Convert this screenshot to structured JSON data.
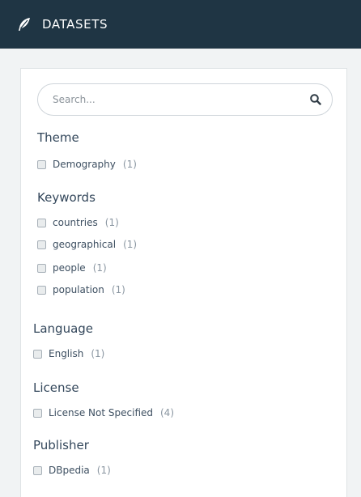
{
  "header": {
    "title": "DATASETS",
    "icon": "feather-icon"
  },
  "search": {
    "placeholder": "Search...",
    "icon": "search-icon"
  },
  "facets": {
    "theme": {
      "title": "Theme",
      "items": [
        {
          "label": "Demography",
          "count": "(1)"
        }
      ]
    },
    "keywords": {
      "title": "Keywords",
      "items": [
        {
          "label": "countries",
          "count": "(1)"
        },
        {
          "label": "geographical",
          "count": "(1)"
        },
        {
          "label": "people",
          "count": "(1)"
        },
        {
          "label": "population",
          "count": "(1)"
        }
      ]
    },
    "language": {
      "title": "Language",
      "items": [
        {
          "label": "English",
          "count": "(1)"
        }
      ]
    },
    "license": {
      "title": "License",
      "items": [
        {
          "label": "License Not Specified",
          "count": "(4)"
        }
      ]
    },
    "publisher": {
      "title": "Publisher",
      "items": [
        {
          "label": "DBpedia",
          "count": "(1)"
        }
      ]
    }
  },
  "colors": {
    "header_bg": "#1f3544",
    "page_bg": "#f1f3f4",
    "panel_bg": "#ffffff",
    "text": "#33475b",
    "count_text": "#8a96a1"
  }
}
